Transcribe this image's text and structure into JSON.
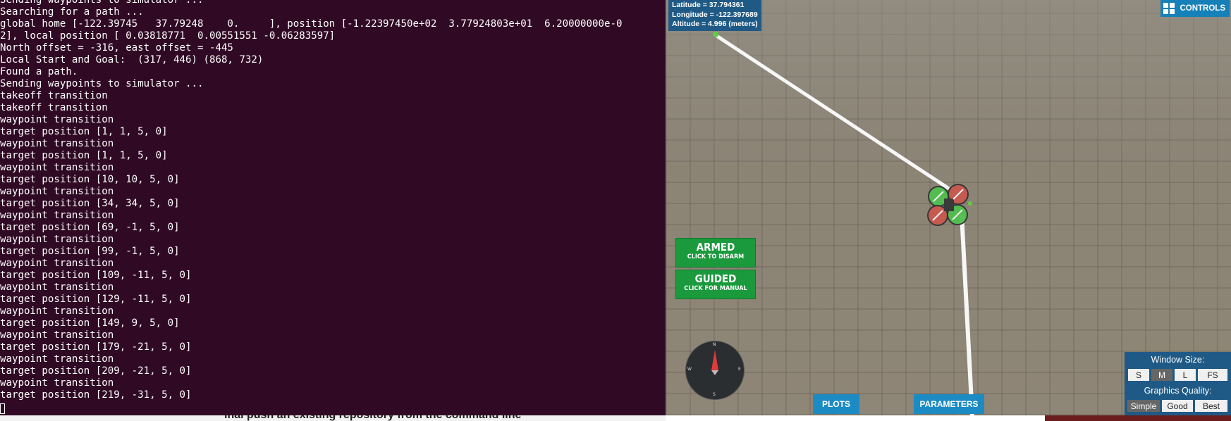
{
  "terminal": {
    "lines": [
      "Sending waypoints to simulator ...",
      "Searching for a path ...",
      "global home [-122.39745   37.79248    0.     ], position [-1.22397450e+02  3.77924803e+01  6.20000000e-0",
      "2], local position [ 0.03818771  0.00551551 -0.06283597]",
      "North offset = -316, east offset = -445",
      "Local Start and Goal:  (317, 446) (868, 732)",
      "Found a path.",
      "Sending waypoints to simulator ...",
      "takeoff transition",
      "takeoff transition",
      "waypoint transition",
      "target position [1, 1, 5, 0]",
      "waypoint transition",
      "target position [1, 1, 5, 0]",
      "waypoint transition",
      "target position [10, 10, 5, 0]",
      "waypoint transition",
      "target position [34, 34, 5, 0]",
      "waypoint transition",
      "target position [69, -1, 5, 0]",
      "waypoint transition",
      "target position [99, -1, 5, 0]",
      "waypoint transition",
      "target position [109, -11, 5, 0]",
      "waypoint transition",
      "target position [129, -11, 5, 0]",
      "waypoint transition",
      "target position [149, 9, 5, 0]",
      "waypoint transition",
      "target position [179, -21, 5, 0]",
      "waypoint transition",
      "target position [209, -21, 5, 0]",
      "waypoint transition",
      "target position [219, -31, 5, 0]"
    ]
  },
  "background": {
    "partial_text": "inal push an existing repository from the command line"
  },
  "simulator": {
    "telemetry": {
      "latitude": "Latitude = 37.794361",
      "longitude": "Longitude = -122.397689",
      "altitude": "Altitude = 4.996 (meters)"
    },
    "controls_label": "CONTROLS",
    "armed": {
      "title": "ARMED",
      "subtitle": "CLICK TO DISARM"
    },
    "guided": {
      "title": "GUIDED",
      "subtitle": "CLICK FOR MANUAL"
    },
    "compass": {
      "n": "N",
      "s": "S",
      "e": "E",
      "w": "W"
    },
    "plots_label": "PLOTS",
    "parameters_label": "PARAMETERS",
    "window_size": {
      "title": "Window Size:",
      "options": [
        "S",
        "M",
        "L",
        "FS"
      ],
      "selected": "M"
    },
    "graphics_quality": {
      "title": "Graphics Quality:",
      "options": [
        "Simple",
        "Good",
        "Best"
      ],
      "selected": "Simple"
    }
  },
  "colors": {
    "terminal_bg": "#300a24",
    "panel_blue": "#1f5a86",
    "button_blue": "#1c8bc4",
    "armed_green": "#1a9a3c"
  }
}
